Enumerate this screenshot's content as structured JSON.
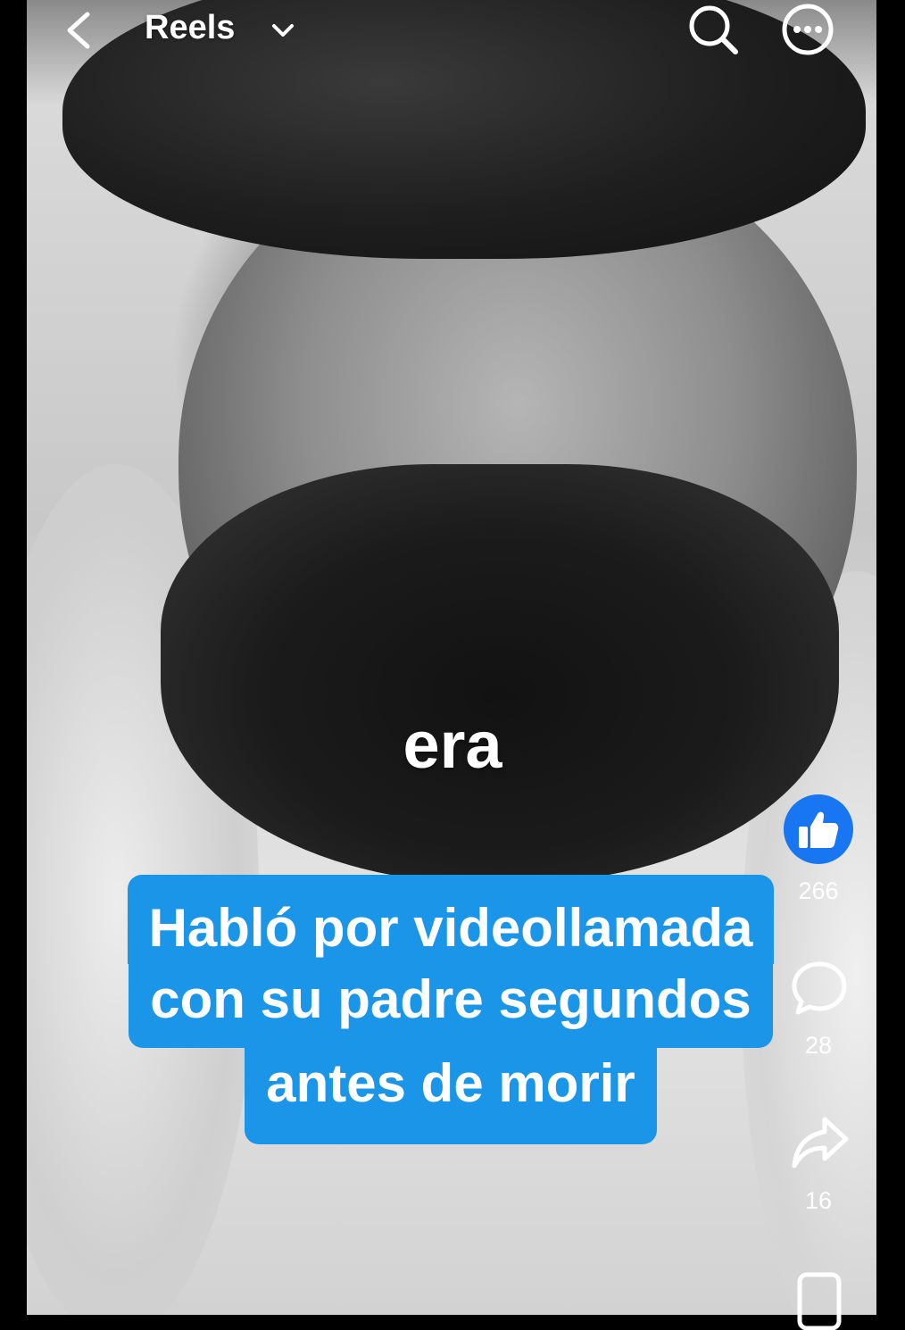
{
  "header": {
    "title": "Reels",
    "icons": [
      "back-icon",
      "chevron-down-icon",
      "search-icon",
      "more-icon"
    ]
  },
  "video": {
    "caption_word": "era",
    "headline_lines": [
      "Habló por videollamada",
      "con su padre segundos",
      "antes de morir"
    ]
  },
  "actions": {
    "like_count": "266",
    "comment_count": "28",
    "share_count": "16"
  },
  "colors": {
    "headline_bg": "#1a95e8",
    "like_bg": "#1876f2",
    "text": "#ffffff"
  }
}
